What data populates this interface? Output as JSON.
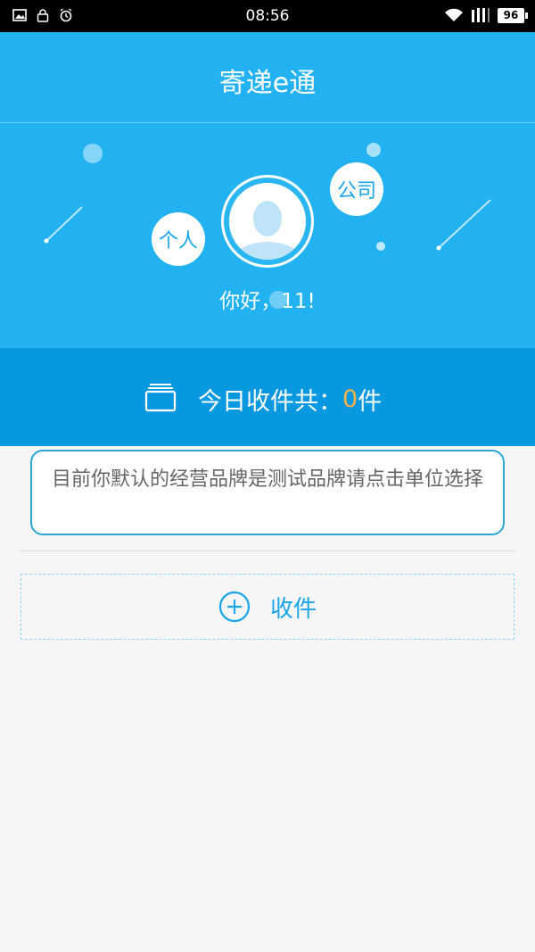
{
  "status_bar": {
    "time": "08:56",
    "battery": "96",
    "icons_left": [
      "image-icon",
      "lock-icon",
      "alarm-icon"
    ],
    "icons_right": [
      "wifi-icon",
      "signal-icon"
    ]
  },
  "header": {
    "title": "寄递e通"
  },
  "hero": {
    "person_label": "个人",
    "company_label": "公司",
    "greeting": "你好，11!"
  },
  "summary": {
    "prefix": "今日收件共：",
    "count": "0",
    "suffix": "件",
    "icon": "inbox-icon"
  },
  "content": {
    "receive_label": "收件",
    "add_icon": "plus-circle-icon"
  },
  "toast": {
    "message": "目前你默认的经营品牌是测试品牌请点击单位选择"
  },
  "colors": {
    "primary": "#22b2f2",
    "primary_dark": "#0898e0",
    "accent_count": "#f6b24a",
    "link_blue": "#1aa5e8",
    "background": "#f6f6f6"
  }
}
